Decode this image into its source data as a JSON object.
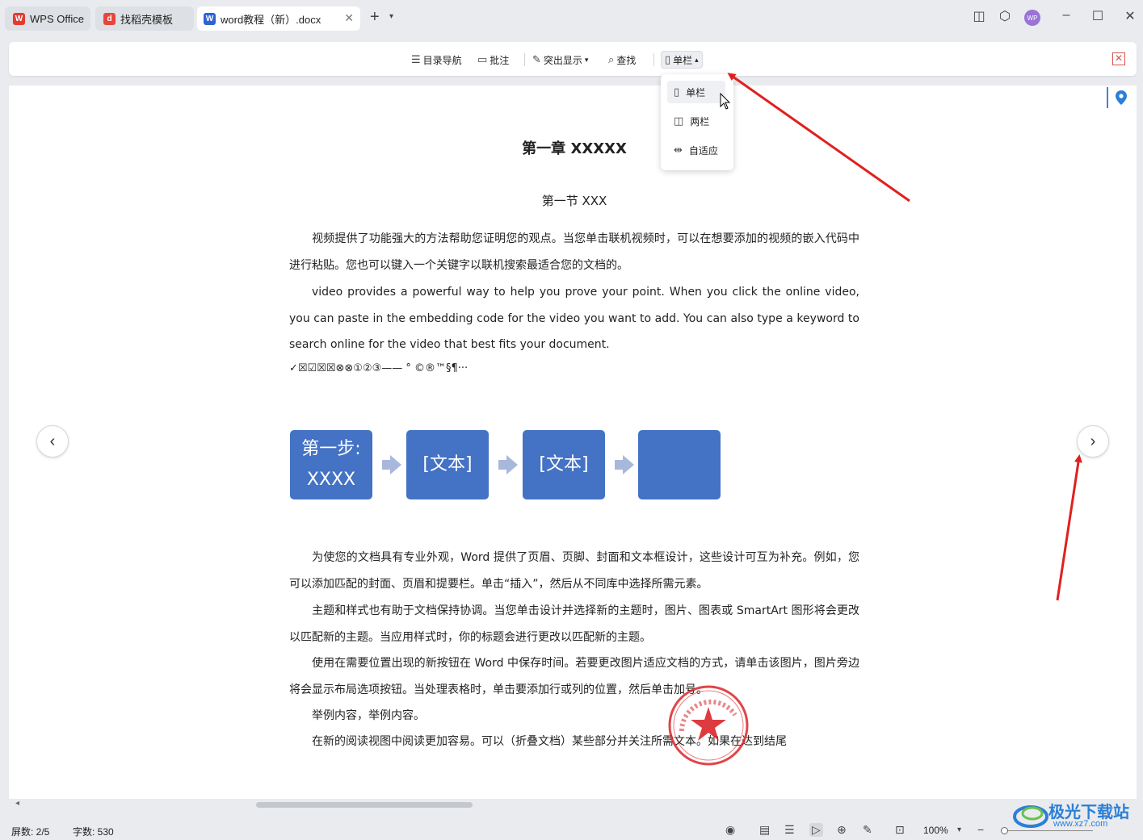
{
  "tabs": [
    {
      "label": "WPS Office",
      "icon": "wps-logo-icon"
    },
    {
      "label": "找稻壳模板",
      "icon": "docer-icon"
    },
    {
      "label": "word教程（新）.docx",
      "icon": "word-doc-icon"
    }
  ],
  "toolbar": {
    "nav": "目录导航",
    "comment": "批注",
    "highlight": "突出显示",
    "find": "查找",
    "column": "单栏"
  },
  "dropdown": {
    "items": [
      "单栏",
      "两栏",
      "自适应"
    ]
  },
  "document": {
    "h1": "第一章  XXXXX",
    "h2": "第一节  XXX",
    "p1": "视频提供了功能强大的方法帮助您证明您的观点。当您单击联机视频时，可以在想要添加的视频的嵌入代码中进行粘贴。您也可以键入一个关键字以联机搜索最适合您的文档的。",
    "p2": "video provides a powerful way to help you prove your point. When you click the online video, you can paste in the embedding code for the video you want to add. You can also type a keyword to search online for the video that best fits your document.",
    "symbols": "✓☒☑☒☒⊗⊗①②③——  ° ©®™§¶···",
    "smartart": {
      "box1_line1": "第一步:",
      "box1_line2": "XXXX",
      "box2": "[文本]",
      "box3": "[文本]",
      "box4": ""
    },
    "p3": "为使您的文档具有专业外观，Word 提供了页眉、页脚、封面和文本框设计，这些设计可互为补充。例如，您可以添加匹配的封面、页眉和提要栏。单击“插入”，然后从不同库中选择所需元素。",
    "p4": "主题和样式也有助于文档保持协调。当您单击设计并选择新的主题时，图片、图表或 SmartArt 图形将会更改以匹配新的主题。当应用样式时，你的标题会进行更改以匹配新的主题。",
    "p5": "使用在需要位置出现的新按钮在 Word 中保存时间。若要更改图片适应文档的方式，请单击该图片，图片旁边将会显示布局选项按钮。当处理表格时，单击要添加行或列的位置，然后单击加号。",
    "p6": "举例内容，举例内容。",
    "p7": "在新的阅读视图中阅读更加容易。可以（折叠文档）某些部分并关注所需文本。如果在达到结尾"
  },
  "status": {
    "screens": "屏数: 2/5",
    "words": "字数: 530",
    "zoom": "100%"
  },
  "watermark": {
    "title": "极光下载站",
    "url": "www.xz7.com"
  },
  "colors": {
    "accent_blue": "#4472c4",
    "annotation_red": "#e02020",
    "stamp_red": "#d9262b"
  }
}
